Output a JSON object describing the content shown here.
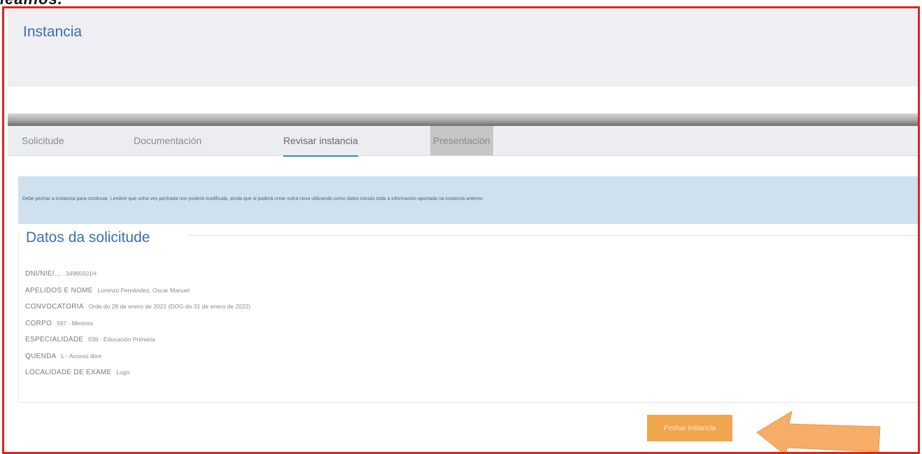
{
  "caption": "lealnos.",
  "header": {
    "title": "Instancia"
  },
  "tabs": [
    {
      "label": "Solicitude",
      "state": "normal"
    },
    {
      "label": "Documentación",
      "state": "normal"
    },
    {
      "label": "Revisar instancia",
      "state": "active"
    },
    {
      "label": "Presentación",
      "state": "disabled"
    }
  ],
  "info_banner": {
    "text": "Debe pechar a instancia para continuar. Lembre que unha vez pechada non poderá modificala, ainda que si poderá crear outra nova utilizando como datos iniciais toda a información aportada na instancia anterior."
  },
  "section": {
    "title": "Datos da solicitude",
    "rows": [
      {
        "label": "DNI/NIE/...",
        "value": "34995501H"
      },
      {
        "label": "APELIDOS E NOME",
        "value": "Lorenzo Fernández, Oscar Manuel"
      },
      {
        "label": "CONVOCATORIA",
        "value": "Orde do 28 de enero de 2022 (DOG do 31 de enero de 2022)"
      },
      {
        "label": "CORPO",
        "value": "597 - Mestres"
      },
      {
        "label": "ESPECIALIDADE",
        "value": "038 - Educación Primaria"
      },
      {
        "label": "QUENDA",
        "value": "L - Acceso libre"
      },
      {
        "label": "LOCALIDADE DE EXAME",
        "value": "Lugo"
      }
    ]
  },
  "submit_button": {
    "label": "Pechar instancia"
  },
  "colors": {
    "frame": "#e0231f",
    "title": "#3a6fb0",
    "banner": "#cfe1ef",
    "button": "#f0a64c",
    "arrow": "#f5ad68",
    "tab_underline": "#2d8fb0"
  }
}
